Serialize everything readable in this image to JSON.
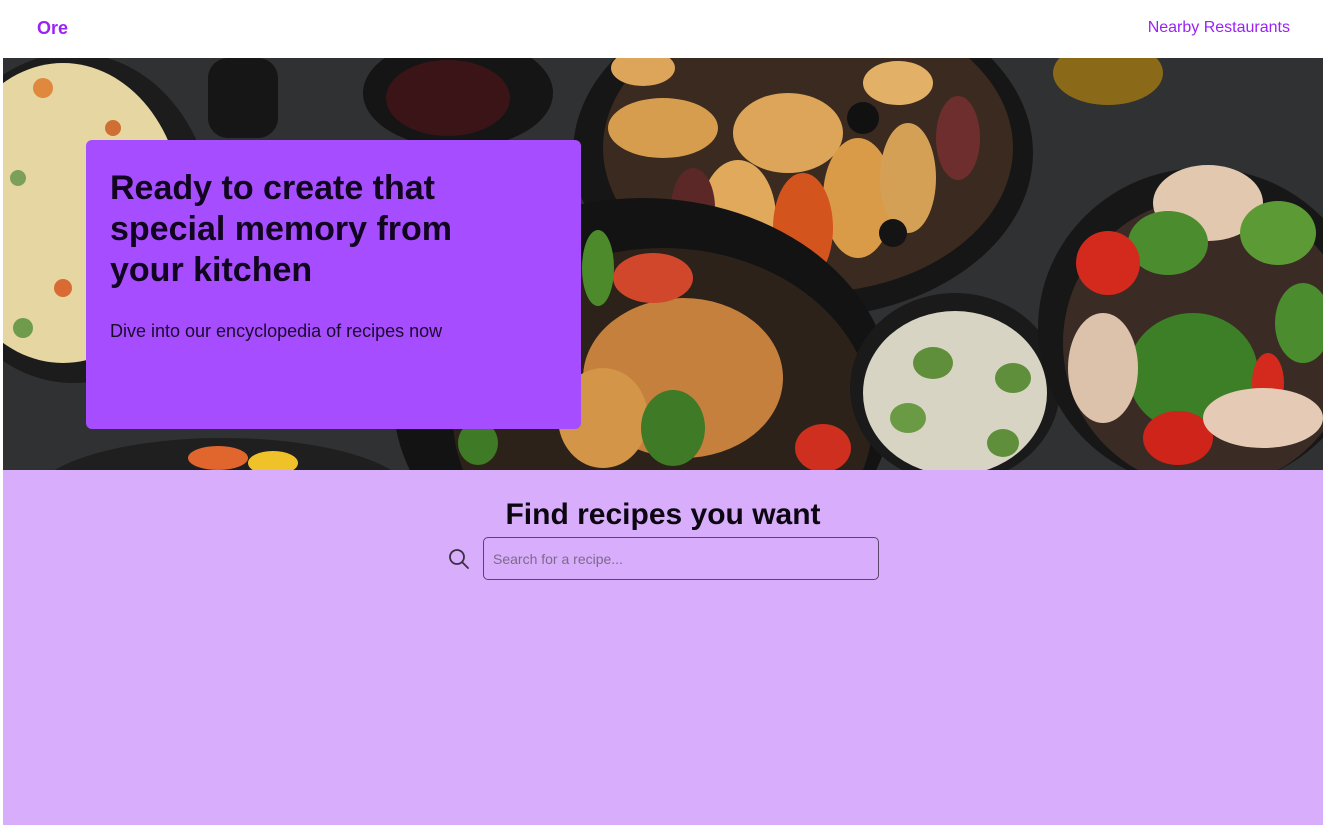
{
  "navbar": {
    "brand": "Ore",
    "nearby_link": "Nearby Restaurants"
  },
  "hero": {
    "title": "Ready to create that special memory from your kitchen",
    "subtitle": "Dive into our encyclopedia of recipes now"
  },
  "search": {
    "heading": "Find recipes you want",
    "placeholder": "Search for a recipe...",
    "value": "",
    "icon": "search-icon"
  },
  "colors": {
    "accent": "#9b22f5",
    "card": "#a64dff",
    "section_bg": "#d8adfb"
  }
}
